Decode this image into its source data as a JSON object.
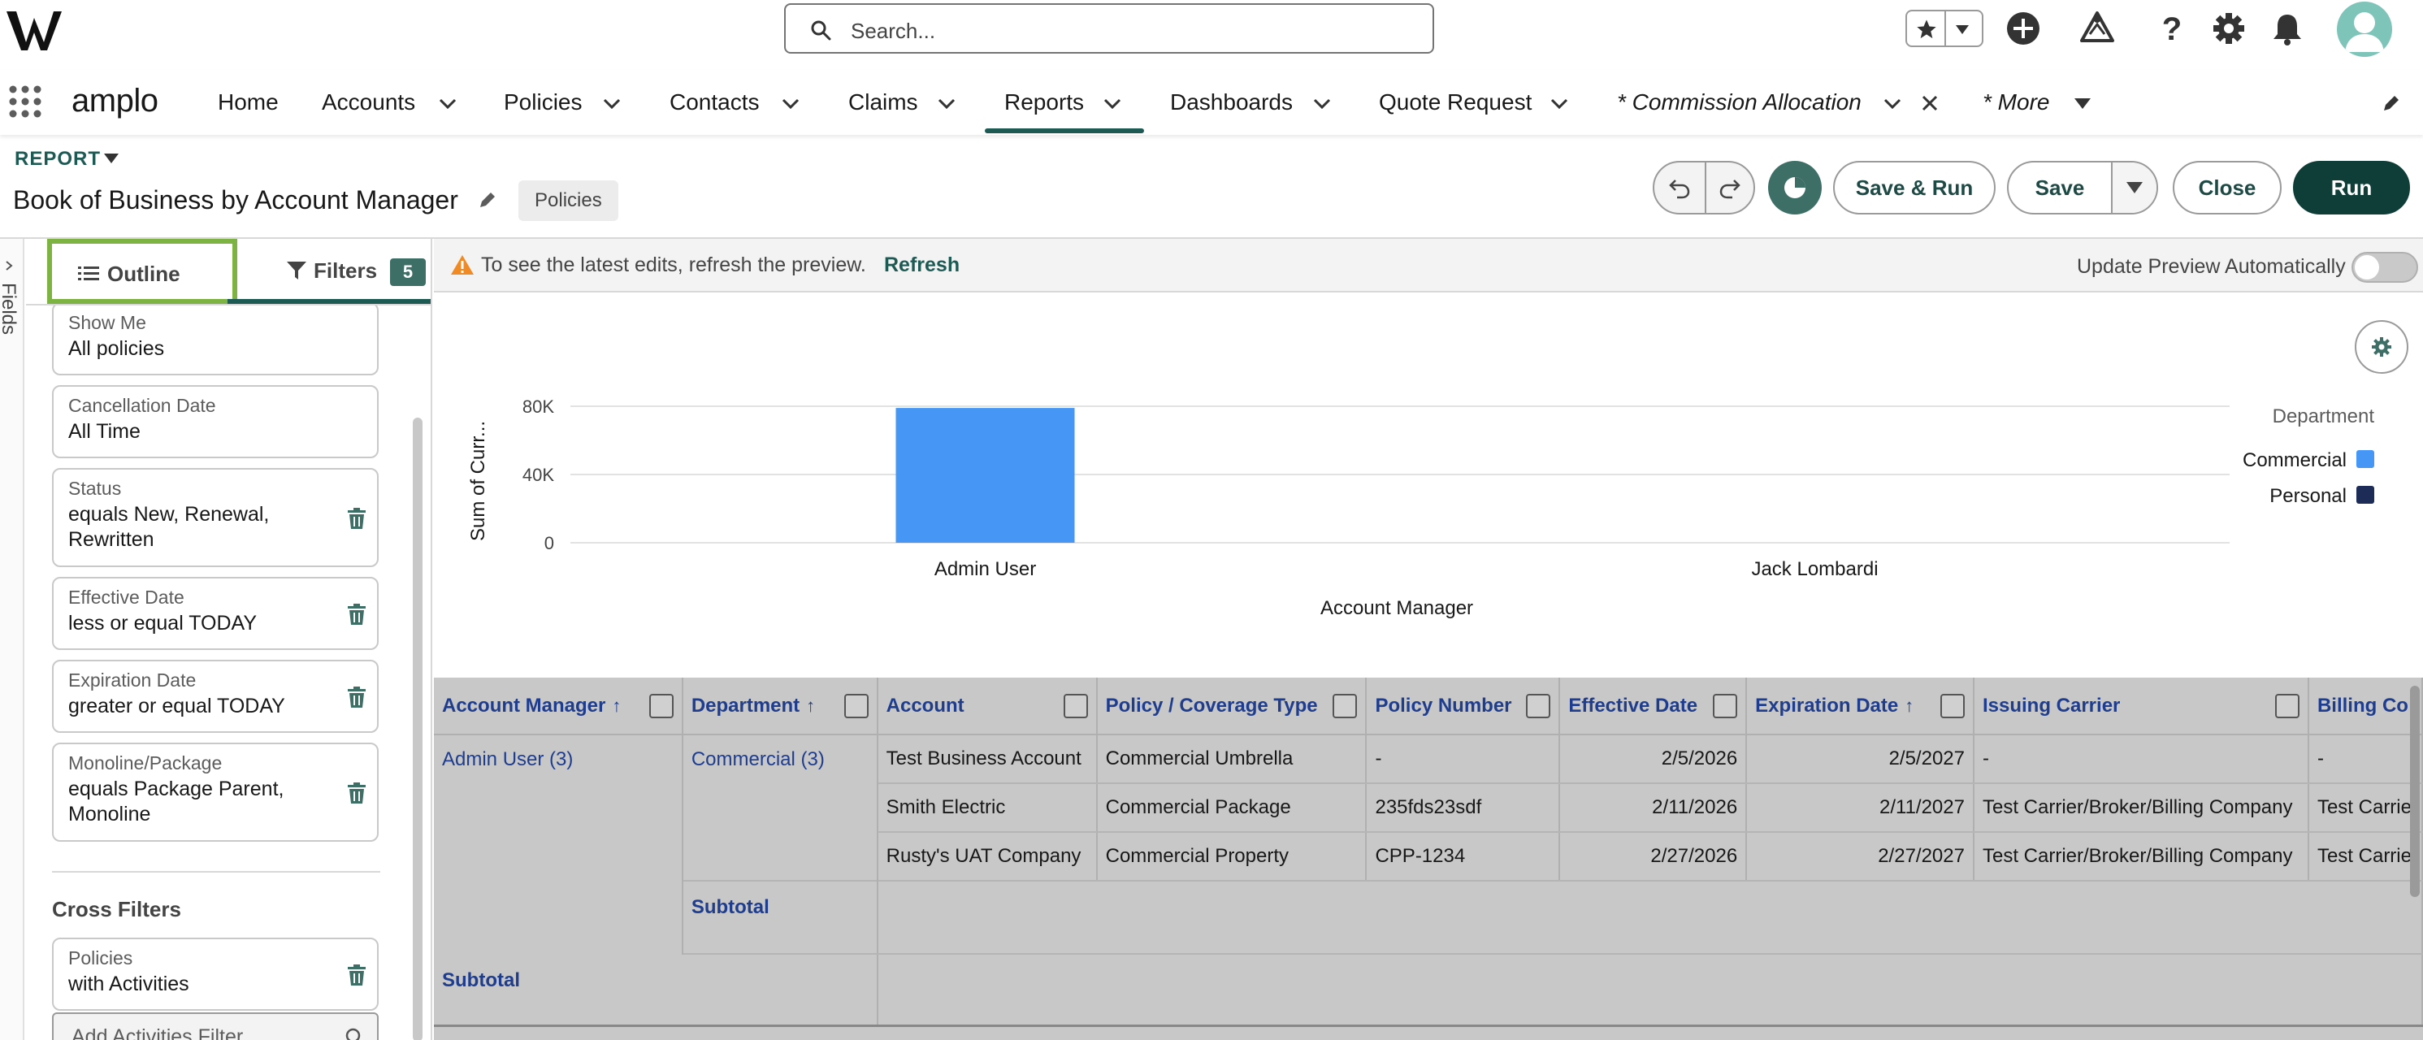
{
  "global": {
    "search_placeholder": "Search..."
  },
  "nav": {
    "app_name": "amplo",
    "items": [
      {
        "label": "Home"
      },
      {
        "label": "Accounts"
      },
      {
        "label": "Policies"
      },
      {
        "label": "Contacts"
      },
      {
        "label": "Claims"
      },
      {
        "label": "Reports",
        "active": true
      },
      {
        "label": "Dashboards"
      },
      {
        "label": "Quote Request"
      },
      {
        "label": "* Commission Allocation"
      },
      {
        "label": "* More"
      }
    ]
  },
  "report": {
    "label": "REPORT",
    "title": "Book of Business by Account Manager",
    "type_badge": "Policies"
  },
  "actions": {
    "save_run": "Save & Run",
    "save": "Save",
    "close": "Close",
    "run": "Run"
  },
  "rail": {
    "label": "Fields"
  },
  "tabs": {
    "outline": "Outline",
    "filters": "Filters",
    "filters_count": "5"
  },
  "filters": [
    {
      "label": "Show Me",
      "value": "All policies",
      "removable": false
    },
    {
      "label": "Cancellation Date",
      "value": "All Time",
      "removable": false
    },
    {
      "label": "Status",
      "value": "equals New, Renewal, Rewritten",
      "removable": true
    },
    {
      "label": "Effective Date",
      "value": "less or equal TODAY",
      "removable": true
    },
    {
      "label": "Expiration Date",
      "value": "greater or equal TODAY",
      "removable": true
    },
    {
      "label": "Monoline/Package",
      "value": "equals Package Parent, Monoline",
      "removable": true
    }
  ],
  "cross_filters": {
    "heading": "Cross Filters",
    "items": [
      {
        "label": "Policies",
        "value": "with Activities"
      }
    ],
    "add_label": "Add Activities Filter"
  },
  "preview": {
    "notice": "To see the latest edits, refresh the preview.",
    "refresh": "Refresh",
    "auto_update_label": "Update Preview Automatically",
    "auto_update_on": false
  },
  "chart_data": {
    "type": "bar",
    "categories": [
      "Admin User",
      "Jack Lombardi"
    ],
    "series": [
      {
        "name": "Commercial",
        "values": [
          79000,
          0
        ],
        "color": "#4596f5"
      },
      {
        "name": "Personal",
        "values": [
          0,
          0
        ],
        "color": "#1d2c56"
      }
    ],
    "xlabel": "Account Manager",
    "ylabel": "Sum of Curr...",
    "ylim": [
      0,
      80000
    ],
    "yticks": [
      "0",
      "40K",
      "80K"
    ],
    "ytick_values": [
      0,
      40000,
      80000
    ],
    "legend_title": "Department",
    "legend_position": "right",
    "grid": true
  },
  "table": {
    "columns": [
      {
        "label": "Account Manager",
        "sorted": true
      },
      {
        "label": "Department",
        "sorted": true
      },
      {
        "label": "Account",
        "sorted": false
      },
      {
        "label": "Policy / Coverage Type",
        "sorted": false
      },
      {
        "label": "Policy Number",
        "sorted": false
      },
      {
        "label": "Effective Date",
        "sorted": false
      },
      {
        "label": "Expiration Date",
        "sorted": true
      },
      {
        "label": "Issuing Carrier",
        "sorted": false
      },
      {
        "label": "Billing Co",
        "sorted": false
      }
    ],
    "group": {
      "manager": "Admin User (3)",
      "department": "Commercial (3)"
    },
    "rows": [
      {
        "account": "Test Business Account",
        "type": "Commercial Umbrella",
        "number": "-",
        "effective": "2/5/2026",
        "expiration": "2/5/2027",
        "carrier": "-",
        "billing": "-"
      },
      {
        "account": "Smith Electric",
        "type": "Commercial Package",
        "number": "235fds23sdf",
        "effective": "2/11/2026",
        "expiration": "2/11/2027",
        "carrier": "Test Carrier/Broker/Billing Company",
        "billing": "Test Carrie"
      },
      {
        "account": "Rusty's UAT Company",
        "type": "Commercial Property",
        "number": "CPP-1234",
        "effective": "2/27/2026",
        "expiration": "2/27/2027",
        "carrier": "Test Carrier/Broker/Billing Company",
        "billing": "Test Carrie"
      }
    ],
    "subtotal_label": "Subtotal"
  },
  "colors": {
    "brand": "#1e5a54",
    "primary_button": "#0f3d37",
    "highlight_outline": "#7cb342",
    "link": "#1e3d8f"
  }
}
